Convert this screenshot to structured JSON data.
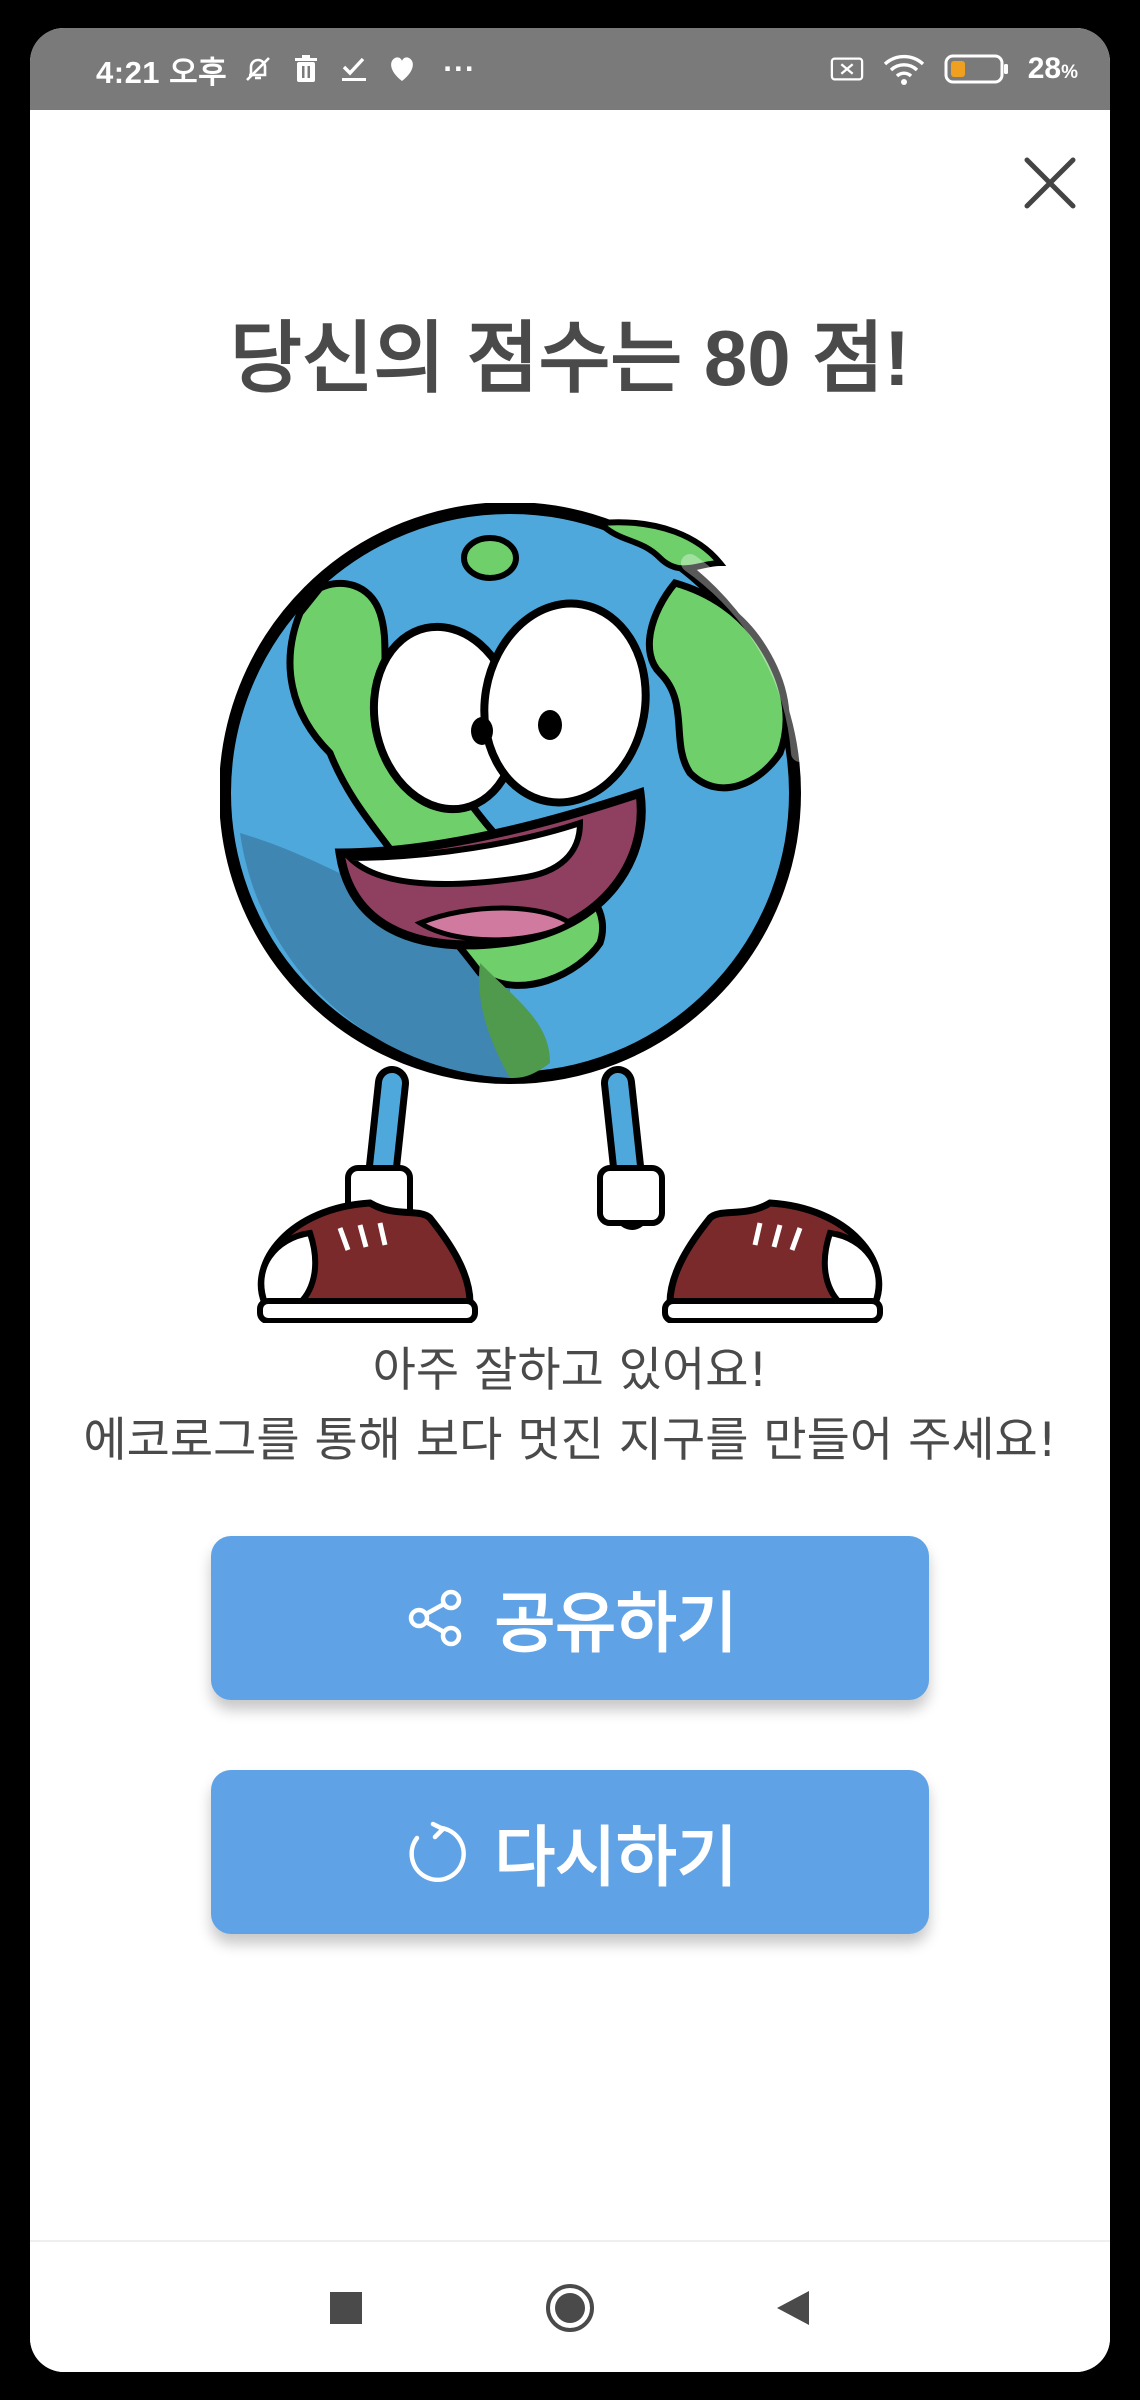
{
  "status_bar": {
    "time": "4:21 오후",
    "more": "···",
    "battery_percent": "28",
    "battery_unit": "%",
    "icons": [
      "mute-icon",
      "trash-icon",
      "check-icon",
      "heart-icon",
      "no-sim-icon",
      "wifi-icon",
      "battery-icon"
    ]
  },
  "result": {
    "title": "당신의 점수는 80 점!",
    "score": 80,
    "message_line1": "아주 잘하고 있어요!",
    "message_line2": "에코로그를 통해 보다 멋진 지구를 만들어 주세요!"
  },
  "buttons": {
    "share_label": "공유하기",
    "retry_label": "다시하기",
    "share_icon": "share-icon",
    "retry_icon": "refresh-icon"
  },
  "nav": {
    "icons": [
      "recents-icon",
      "home-icon",
      "back-icon"
    ]
  },
  "colors": {
    "button": "#5fa2e5",
    "status_bar": "#7a7a7a",
    "text": "#4a4a4a",
    "ocean": "#4ea8dc",
    "land": "#6fcf6a",
    "shoe": "#7a2a2a"
  }
}
